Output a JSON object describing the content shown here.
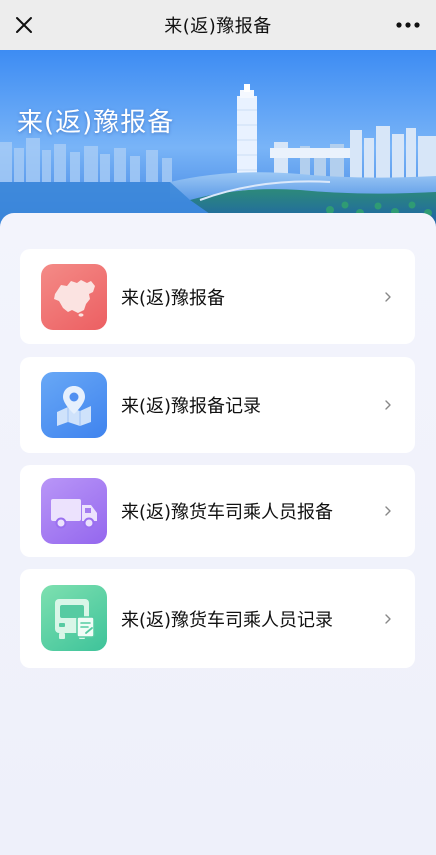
{
  "navbar": {
    "title": "来(返)豫报备",
    "close_icon": "close-icon",
    "more_icon": "more-dots-icon"
  },
  "banner": {
    "title": "来(返)豫报备"
  },
  "menu": [
    {
      "label": "来(返)豫报备",
      "icon": "china-map-icon",
      "color": "#f06e6e"
    },
    {
      "label": "来(返)豫报备记录",
      "icon": "map-pin-icon",
      "color": "#4c8ff2"
    },
    {
      "label": "来(返)豫货车司乘人员报备",
      "icon": "truck-icon",
      "color": "#a47cf0"
    },
    {
      "label": "来(返)豫货车司乘人员记录",
      "icon": "bus-record-icon",
      "color": "#3fc79a"
    }
  ]
}
